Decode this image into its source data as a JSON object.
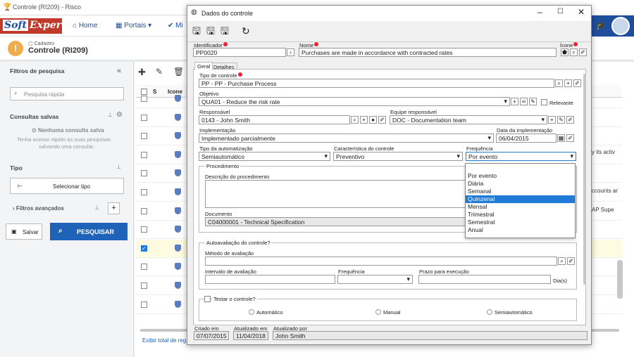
{
  "window": {
    "title": "Controle (RI209) - Risco"
  },
  "topnav": {
    "brand": "Soft",
    "brand_b": "Exper",
    "home": "Home",
    "portais": "Portais",
    "mi": "Mi"
  },
  "page": {
    "crumb": "Cadastro",
    "title": "Controle (RI209)"
  },
  "sidebar": {
    "filters_title": "Filtros de pesquisa",
    "search_placeholder": "Pesquisa rápida",
    "saved_title": "Consultas salvas",
    "saved_empty_title": "Nenhuma consulta salva",
    "saved_empty_line1": "Tenha acesso rápido às suas pesquisas",
    "saved_empty_line2": "salvando uma consulta.",
    "type_title": "Tipo",
    "select_type": "Selecionar tipo",
    "advanced": "Filtros avançados",
    "save": "Salvar",
    "search": "PESQUISAR"
  },
  "grid": {
    "col_s": "S",
    "col_icone": "Icone",
    "footer": "Exibir total de reg",
    "side_text1": "y its activ",
    "side_text2": "ccounts ar",
    "side_text3": "AP Supe"
  },
  "modal": {
    "title": "Dados do controle",
    "identificador_label": "Identificador",
    "identificador": "PP0020",
    "nome_label": "Nome",
    "nome": "Purchases are made in accordance with contracted rates",
    "icone_label": "Ícone",
    "tabs": [
      "Geral",
      "Detalhes"
    ],
    "tipo_label": "Tipo de controle",
    "tipo": "PP - PP - Purchase Process",
    "objetivo_label": "Objetivo",
    "objetivo": "QUA01 - Reduce the risk rate",
    "relevante": "Relevante",
    "responsavel_label": "Responsável",
    "responsavel": "0143 - John Smith",
    "equipe_label": "Equipe responsável",
    "equipe": "DOC - Documentation team",
    "implementacao_label": "Implementação",
    "implementacao": "Implementado parcialmente",
    "data_impl_label": "Data da implementação",
    "data_impl": "06/04/2015",
    "automatizacao_label": "Tipo da automatização",
    "automatizacao": "Semiautomático",
    "caracteristica_label": "Característica do controle",
    "caracteristica": "Preventivo",
    "frequencia_label": "Frequência",
    "frequencia": "Por evento",
    "procedimento_title": "Procedimento",
    "desc_proc_label": "Descrição do procedimento",
    "documento_label": "Documento",
    "documento": "C04000001 - Technical Specification",
    "autoavaliacao_title": "Autoavaliação do controle?",
    "metodo_label": "Método de avaliação",
    "intervalo_label": "Intervalo de avaliação",
    "freq2_label": "Frequência",
    "prazo_label": "Prazo para execução",
    "dias": "Dia(s)",
    "testar_title": "Testar o controle?",
    "radio_auto": "Automático",
    "radio_manual": "Manual",
    "radio_semi": "Semiautomático",
    "criado_label": "Criado em",
    "criado": "07/07/2015",
    "atualizado_label": "Atualizado em",
    "atualizado": "11/04/2018",
    "atualizado_por_label": "Atualizado por",
    "atualizado_por": "John Smith",
    "freq_options": [
      "Por evento",
      "Diária",
      "Semanal",
      "Quinzenal",
      "Mensal",
      "Trimestral",
      "Semestral",
      "Anual"
    ],
    "freq_selected_index": 3
  }
}
